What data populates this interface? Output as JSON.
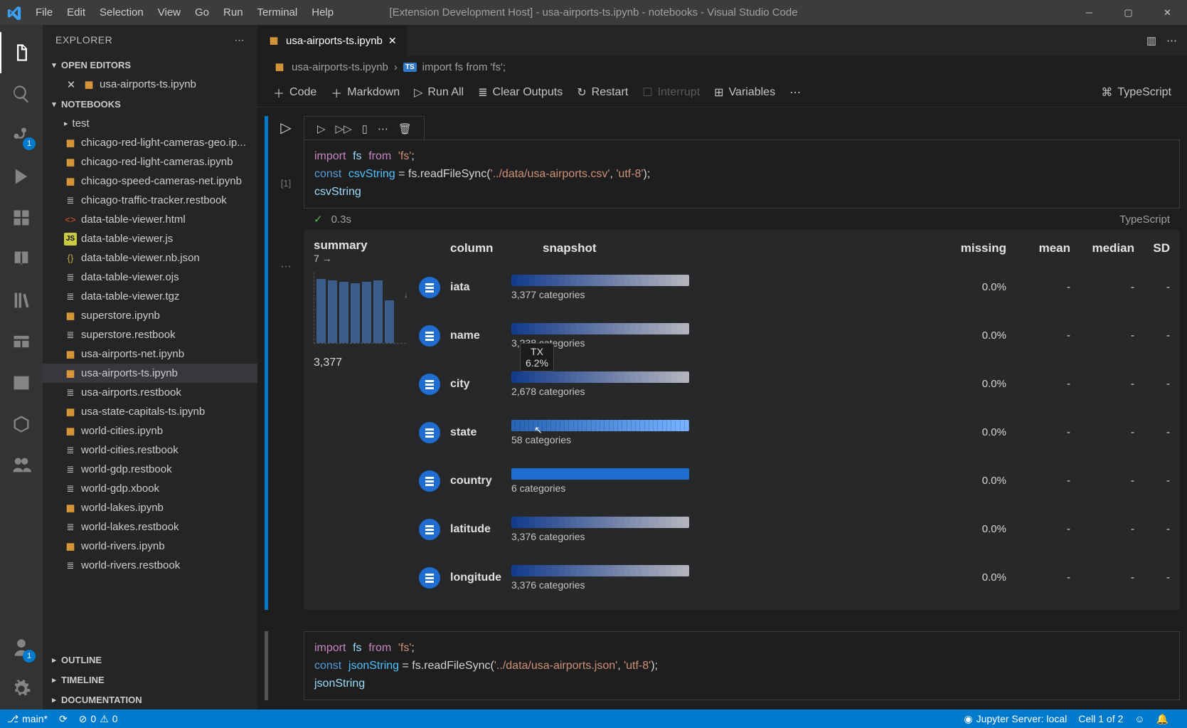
{
  "window": {
    "title": "[Extension Development Host] - usa-airports-ts.ipynb - notebooks - Visual Studio Code"
  },
  "menu": {
    "items": [
      "File",
      "Edit",
      "Selection",
      "View",
      "Go",
      "Run",
      "Terminal",
      "Help"
    ]
  },
  "explorer": {
    "title": "EXPLORER",
    "openEditors": "OPEN EDITORS",
    "openFile": "usa-airports-ts.ipynb",
    "notebooksSection": "NOTEBOOKS",
    "folder": "test",
    "files": [
      {
        "name": "chicago-red-light-cameras-geo.ip...",
        "icon": "nb"
      },
      {
        "name": "chicago-red-light-cameras.ipynb",
        "icon": "nb"
      },
      {
        "name": "chicago-speed-cameras-net.ipynb",
        "icon": "nb"
      },
      {
        "name": "chicago-traffic-tracker.restbook",
        "icon": "lines"
      },
      {
        "name": "data-table-viewer.html",
        "icon": "html"
      },
      {
        "name": "data-table-viewer.js",
        "icon": "js"
      },
      {
        "name": "data-table-viewer.nb.json",
        "icon": "json"
      },
      {
        "name": "data-table-viewer.ojs",
        "icon": "lines"
      },
      {
        "name": "data-table-viewer.tgz",
        "icon": "lines"
      },
      {
        "name": "superstore.ipynb",
        "icon": "nb"
      },
      {
        "name": "superstore.restbook",
        "icon": "lines"
      },
      {
        "name": "usa-airports-net.ipynb",
        "icon": "nb"
      },
      {
        "name": "usa-airports-ts.ipynb",
        "icon": "nb",
        "active": true
      },
      {
        "name": "usa-airports.restbook",
        "icon": "lines"
      },
      {
        "name": "usa-state-capitals-ts.ipynb",
        "icon": "nb"
      },
      {
        "name": "world-cities.ipynb",
        "icon": "nb"
      },
      {
        "name": "world-cities.restbook",
        "icon": "lines"
      },
      {
        "name": "world-gdp.restbook",
        "icon": "lines"
      },
      {
        "name": "world-gdp.xbook",
        "icon": "lines"
      },
      {
        "name": "world-lakes.ipynb",
        "icon": "nb"
      },
      {
        "name": "world-lakes.restbook",
        "icon": "lines"
      },
      {
        "name": "world-rivers.ipynb",
        "icon": "nb"
      },
      {
        "name": "world-rivers.restbook",
        "icon": "lines"
      }
    ],
    "outline": "OUTLINE",
    "timeline": "TIMELINE",
    "documentation": "DOCUMENTATION"
  },
  "tab": {
    "filename": "usa-airports-ts.ipynb"
  },
  "breadcrumb": {
    "file": "usa-airports-ts.ipynb",
    "crumb2": "import fs from 'fs';"
  },
  "toolbar": {
    "code": "Code",
    "markdown": "Markdown",
    "runAll": "Run All",
    "clearOutputs": "Clear Outputs",
    "restart": "Restart",
    "interrupt": "Interrupt",
    "variables": "Variables",
    "kernel": "TypeScript"
  },
  "cell1": {
    "prompt": "[1]",
    "duration": "0.3s",
    "lang": "TypeScript",
    "code": {
      "line1a": "import",
      "line1b": "fs",
      "line1c": "from",
      "line1d": "'fs'",
      "line1e": ";",
      "line2a": "const",
      "line2b": "csvString",
      "line2c": " = fs.readFileSync(",
      "line2d": "'../data/usa-airports.csv'",
      "line2e": ", ",
      "line2f": "'utf-8'",
      "line2g": ");",
      "line3": "csvString"
    }
  },
  "summary": {
    "title": "summary",
    "rowsArrow": "7 →",
    "totalRows": "3,377",
    "headers": {
      "column": "column",
      "snapshot": "snapshot",
      "missing": "missing",
      "mean": "mean",
      "median": "median",
      "sd": "SD"
    },
    "rows": [
      {
        "name": "iata",
        "cats": "3,377 categories",
        "missing": "0.0%",
        "mean": "-",
        "median": "-",
        "sd": "-",
        "kind": "grad"
      },
      {
        "name": "name",
        "cats": "3,238 categories",
        "missing": "0.0%",
        "mean": "-",
        "median": "-",
        "sd": "-",
        "kind": "grad"
      },
      {
        "name": "city",
        "cats": "2,678 categories",
        "missing": "0.0%",
        "mean": "-",
        "median": "-",
        "sd": "-",
        "kind": "grad",
        "tooltip": true
      },
      {
        "name": "state",
        "cats": "58 categories",
        "missing": "0.0%",
        "mean": "-",
        "median": "-",
        "sd": "-",
        "kind": "stripe"
      },
      {
        "name": "country",
        "cats": "6 categories",
        "missing": "0.0%",
        "mean": "-",
        "median": "-",
        "sd": "-",
        "kind": "solid"
      },
      {
        "name": "latitude",
        "cats": "3,376 categories",
        "missing": "0.0%",
        "mean": "-",
        "median": "-",
        "sd": "-",
        "kind": "grad"
      },
      {
        "name": "longitude",
        "cats": "3,376 categories",
        "missing": "0.0%",
        "mean": "-",
        "median": "-",
        "sd": "-",
        "kind": "grad"
      }
    ],
    "tooltip": {
      "label": "TX",
      "pct": "6.2%"
    }
  },
  "chart_data": {
    "type": "table",
    "title": "summary",
    "total_rows": 3377,
    "num_columns": 7,
    "columns": [
      "column",
      "snapshot",
      "missing",
      "mean",
      "median",
      "SD"
    ],
    "rows": [
      {
        "column": "iata",
        "categories": 3377,
        "missing_pct": 0.0,
        "mean": null,
        "median": null,
        "sd": null
      },
      {
        "column": "name",
        "categories": 3238,
        "missing_pct": 0.0,
        "mean": null,
        "median": null,
        "sd": null
      },
      {
        "column": "city",
        "categories": 2678,
        "missing_pct": 0.0,
        "mean": null,
        "median": null,
        "sd": null
      },
      {
        "column": "state",
        "categories": 58,
        "missing_pct": 0.0,
        "mean": null,
        "median": null,
        "sd": null,
        "hover": {
          "value": "TX",
          "share_pct": 6.2
        }
      },
      {
        "column": "country",
        "categories": 6,
        "missing_pct": 0.0,
        "mean": null,
        "median": null,
        "sd": null
      },
      {
        "column": "latitude",
        "categories": 3376,
        "missing_pct": 0.0,
        "mean": null,
        "median": null,
        "sd": null
      },
      {
        "column": "longitude",
        "categories": 3376,
        "missing_pct": 0.0,
        "mean": null,
        "median": null,
        "sd": null
      }
    ],
    "summary_histogram": {
      "bars": 7,
      "heights": [
        90,
        88,
        86,
        84,
        86,
        88,
        60
      ]
    }
  },
  "cell2": {
    "code": {
      "line1a": "import",
      "line1b": "fs",
      "line1c": "from",
      "line1d": "'fs'",
      "line1e": ";",
      "line2a": "const",
      "line2b": "jsonString",
      "line2c": " = fs.readFileSync(",
      "line2d": "'../data/usa-airports.json'",
      "line2e": ", ",
      "line2f": "'utf-8'",
      "line2g": ");",
      "line3": "jsonString"
    }
  },
  "statusbar": {
    "branch": "main*",
    "errors": "0",
    "warnings": "0",
    "jupyter": "Jupyter Server: local",
    "cellpos": "Cell 1 of 2"
  }
}
